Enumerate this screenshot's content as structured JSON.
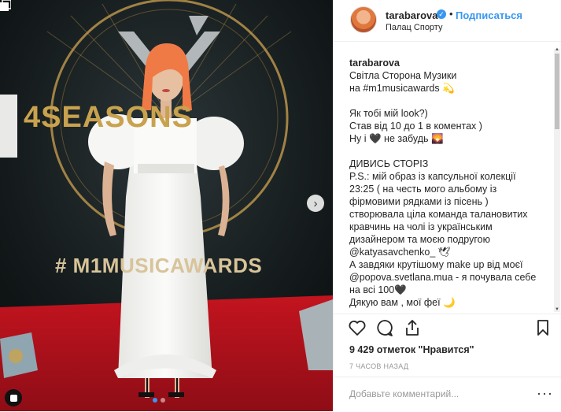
{
  "photo": {
    "stage_title": "4SEASONS",
    "stage_hashtag": "# M1MUSICAWARDS",
    "next_glyph": "›"
  },
  "header": {
    "username": "tarabarova",
    "verified_glyph": "✓",
    "separator": "•",
    "follow_label": "Подписаться",
    "location": "Палац Спорту"
  },
  "caption": {
    "username": "tarabarova",
    "lines": [
      "Світла Сторона Музики",
      "на #m1musicawards 💫",
      "",
      "Як тобі мій look?)",
      "Став від 10 до 1 в коментах )",
      "Ну і 🖤 не забудь 🌄",
      "",
      "ДИВИСЬ СТОРІЗ",
      "P.S.: мій образ із капсульної колекції",
      "23:25 ( на честь мого альбому із",
      "фірмовими рядками із пісень )",
      " створювала ціла команда талановитих",
      "кравчинь на чолі із українським",
      "дизайнером та моєю подругою",
      "@katyasavchenko_ 🕊",
      "А завдяки крутішому make up від моєї",
      "@popova.svetlana.mua - я почувала себе",
      "на всі 100🖤",
      "Дякую вам , мої феї 🌙"
    ]
  },
  "actions": {
    "like_icon": "heart-icon",
    "comment_icon": "comment-icon",
    "share_icon": "share-icon",
    "save_icon": "bookmark-icon"
  },
  "likes": "9 429 отметок \"Нравится\"",
  "time": "7 ЧАСОВ НАЗАД",
  "comment": {
    "placeholder": "Добавьте комментарий...",
    "more_label": "···"
  },
  "colors": {
    "accent": "#3897f0",
    "carpet": "#b3121e",
    "dress": "#f4f4f2",
    "hair": "#f07a45"
  }
}
